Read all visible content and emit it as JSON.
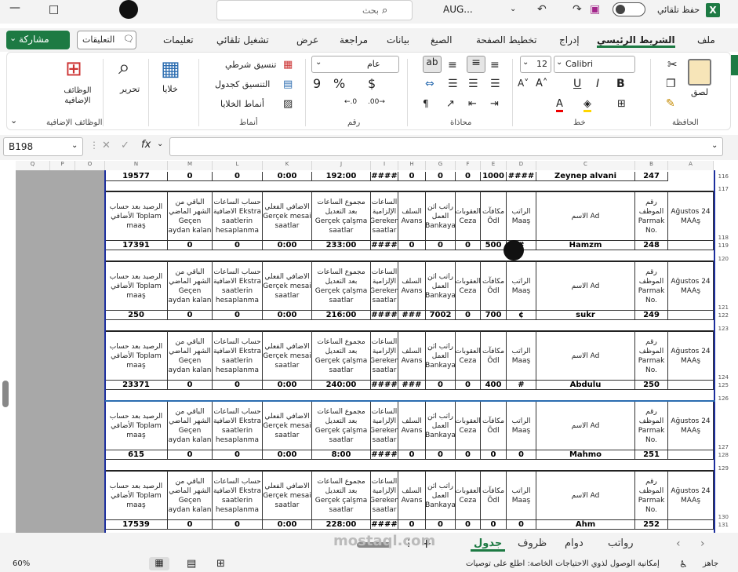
{
  "titlebar": {
    "autosave_label": "حفظ تلقائي",
    "filename": "AUG...",
    "search_placeholder": "بحث"
  },
  "menu": {
    "tabs": [
      "ملف",
      "الشريط الرئيسي",
      "إدراج",
      "تخطيط الصفحة",
      "الصيغ",
      "بيانات",
      "مراجعة",
      "عرض",
      "تشغيل تلقائي",
      "تعليمات"
    ],
    "comments_label": "التعليقات",
    "share_label": "مشاركة"
  },
  "ribbon": {
    "clipboard": {
      "label": "الحافظة",
      "paste": "لصق"
    },
    "font": {
      "label": "خط",
      "name": "Calibri",
      "size": "12",
      "bold": "B",
      "italic": "I",
      "underline": "U"
    },
    "alignment": {
      "label": "محاذاة"
    },
    "number": {
      "label": "رقم",
      "format": "عام",
      "currency": "$",
      "percent": "%",
      "comma": "9"
    },
    "styles": {
      "label": "أنماط",
      "conditional": "تنسيق شرطي",
      "table": "التنسيق كجدول",
      "cell_styles": "أنماط الخلايا"
    },
    "cells": {
      "label": "خلايا"
    },
    "editing": {
      "label": "تحرير"
    },
    "addins": {
      "label": "الوظائف الإضافية",
      "title": "الوظائف الإضافية"
    }
  },
  "formula_bar": {
    "name_box": "B198",
    "fx": "fx"
  },
  "columns": [
    "Q",
    "P",
    "O",
    "N",
    "M",
    "L",
    "K",
    "J",
    "I",
    "H",
    "G",
    "F",
    "E",
    "D",
    "C",
    "B",
    "A"
  ],
  "headers": {
    "n": "الرصيد بعد حساب الأضافي Toplam maaş",
    "m": "الباقي من الشهر الماضي Geçen aydan kalan",
    "l": "حساب الساعات الاضافية Ekstra saatlerin hesaplanma",
    "k": "الاضافي الفعلي Gerçek mesai saatlar",
    "j": "مجموع الساعات بعد التعديل Gerçek çalşma saatlar",
    "i": "الساعات الإلزامية Gereken saatlar",
    "h": "السلف Avans",
    "g": "راتب اثن العمل Bankaya",
    "f": "العقوبات Ceza",
    "e": "مكافآت Ödl",
    "d": "الراتب Maaş",
    "c": "الاسم Ad",
    "b": "رقم الموظف Parmak No.",
    "a": "Ağustos 24 MAAş"
  },
  "top_row": {
    "n": "19577",
    "m": "0",
    "l": "0",
    "k": "0:00",
    "j": "192:00",
    "i": "####",
    "h": "0",
    "g": "0",
    "f": "0",
    "e": "1000",
    "d": "####",
    "c": "Zeynep alvani",
    "b": "247"
  },
  "blocks": [
    {
      "n": "17391",
      "m": "0",
      "l": "0",
      "k": "0:00",
      "j": "233:00",
      "i": "####",
      "h": "0",
      "g": "0",
      "f": "0",
      "e": "500",
      "d": "#",
      "c": "Hamzm",
      "b": "248",
      "rows": [
        "117",
        "118",
        "119"
      ]
    },
    {
      "n": "250",
      "m": "0",
      "l": "0",
      "k": "0:00",
      "j": "216:00",
      "i": "####",
      "h": "###",
      "g": "7002",
      "f": "0",
      "e": "700",
      "d": "¢",
      "c": "sukr",
      "b": "249",
      "rows": [
        "120",
        "121",
        "122"
      ]
    },
    {
      "n": "23371",
      "m": "0",
      "l": "0",
      "k": "0:00",
      "j": "240:00",
      "i": "####",
      "h": "###",
      "g": "0",
      "f": "0",
      "e": "400",
      "d": "#",
      "c": "Abdulu",
      "b": "250",
      "rows": [
        "123",
        "124",
        "125"
      ]
    },
    {
      "n": "615",
      "m": "0",
      "l": "0",
      "k": "0:00",
      "j": "8:00",
      "i": "####",
      "h": "0",
      "g": "0",
      "f": "0",
      "e": "0",
      "d": "0",
      "c": "Mahmo",
      "b": "251",
      "rows": [
        "126",
        "127",
        "128"
      ]
    },
    {
      "n": "17539",
      "m": "0",
      "l": "0",
      "k": "0:00",
      "j": "228:00",
      "i": "####",
      "h": "0",
      "g": "0",
      "f": "0",
      "e": "0",
      "d": "0",
      "c": "Ahm",
      "b": "252",
      "rows": [
        "129",
        "130",
        "131"
      ]
    }
  ],
  "row_116": "116",
  "sheet_tabs": [
    "رواتب",
    "دوام",
    "ظروف",
    "جدول"
  ],
  "active_tab": "جدول",
  "status": {
    "ready": "جاهز",
    "accessibility": "إمكانية الوصول لذوي الاحتياجات الخاصة: اطلع على توصيات",
    "zoom": "60%"
  },
  "watermark": "mostaql.com"
}
